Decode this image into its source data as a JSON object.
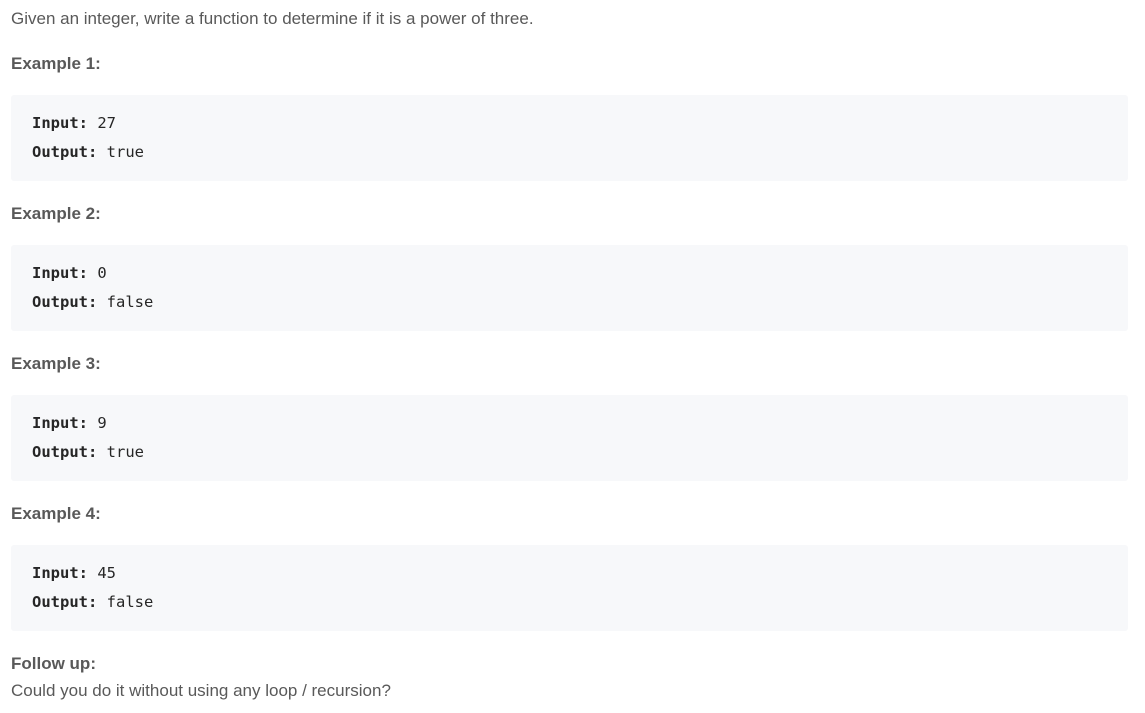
{
  "problem": {
    "description": "Given an integer, write a function to determine if it is a power of three."
  },
  "examples": [
    {
      "heading": "Example 1:",
      "input_label": "Input:",
      "input_value": " 27",
      "output_label": "Output:",
      "output_value": " true"
    },
    {
      "heading": "Example 2:",
      "input_label": "Input:",
      "input_value": " 0",
      "output_label": "Output:",
      "output_value": " false"
    },
    {
      "heading": "Example 3:",
      "input_label": "Input:",
      "input_value": " 9",
      "output_label": "Output:",
      "output_value": " true"
    },
    {
      "heading": "Example 4:",
      "input_label": "Input:",
      "input_value": " 45",
      "output_label": "Output:",
      "output_value": " false"
    }
  ],
  "follow_up": {
    "heading": "Follow up:",
    "text": "Could you do it without using any loop / recursion?"
  }
}
